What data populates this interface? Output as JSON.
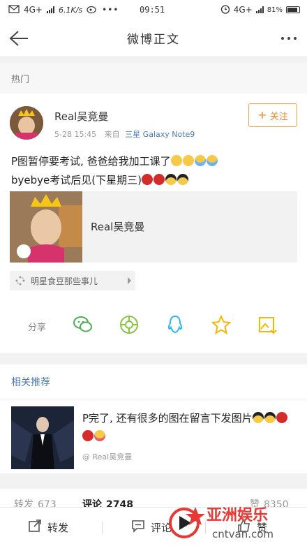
{
  "status": {
    "network_left": "4G+",
    "speed": "6.1K/s",
    "time": "09:51",
    "network_right": "4G+",
    "battery": "81%"
  },
  "nav": {
    "title": "微博正文"
  },
  "sections": {
    "hot_label": "热门",
    "recommend_label": "相关推荐"
  },
  "post": {
    "author": "Real吴竞曼",
    "date": "5-28 15:45",
    "source_prefix": "来自",
    "source_device": "三星 Galaxy Note9",
    "follow_label": "关注",
    "text_line1": "P图暂停要考试, 爸爸给我加工课了",
    "text_line2": "byebye考试后见(下星期三)",
    "repost_author": "Real吴竞曼",
    "topic": "明星食豆那些事儿"
  },
  "share": {
    "label": "分享",
    "icons": [
      "wechat-icon",
      "moments-icon",
      "qq-icon",
      "qzone-icon",
      "save-image-icon"
    ]
  },
  "recommend": {
    "text": "P完了, 还有很多的图在留言下发图片",
    "author": "@ Real吴竞曼"
  },
  "stats": {
    "repost_label": "转发",
    "repost_count": "673",
    "comment_label": "评论",
    "comment_count": "2748",
    "like_label": "赞",
    "like_count": "8350"
  },
  "bottom": {
    "repost_label": "转发",
    "comment_label": "评论",
    "like_label": "赞"
  },
  "watermark": {
    "name": "亚洲娱乐",
    "url": "cntvan.com"
  },
  "colors": {
    "accent_orange": "#e8872a",
    "link_blue": "#4a7ab5",
    "watermark_red": "#e53935"
  }
}
